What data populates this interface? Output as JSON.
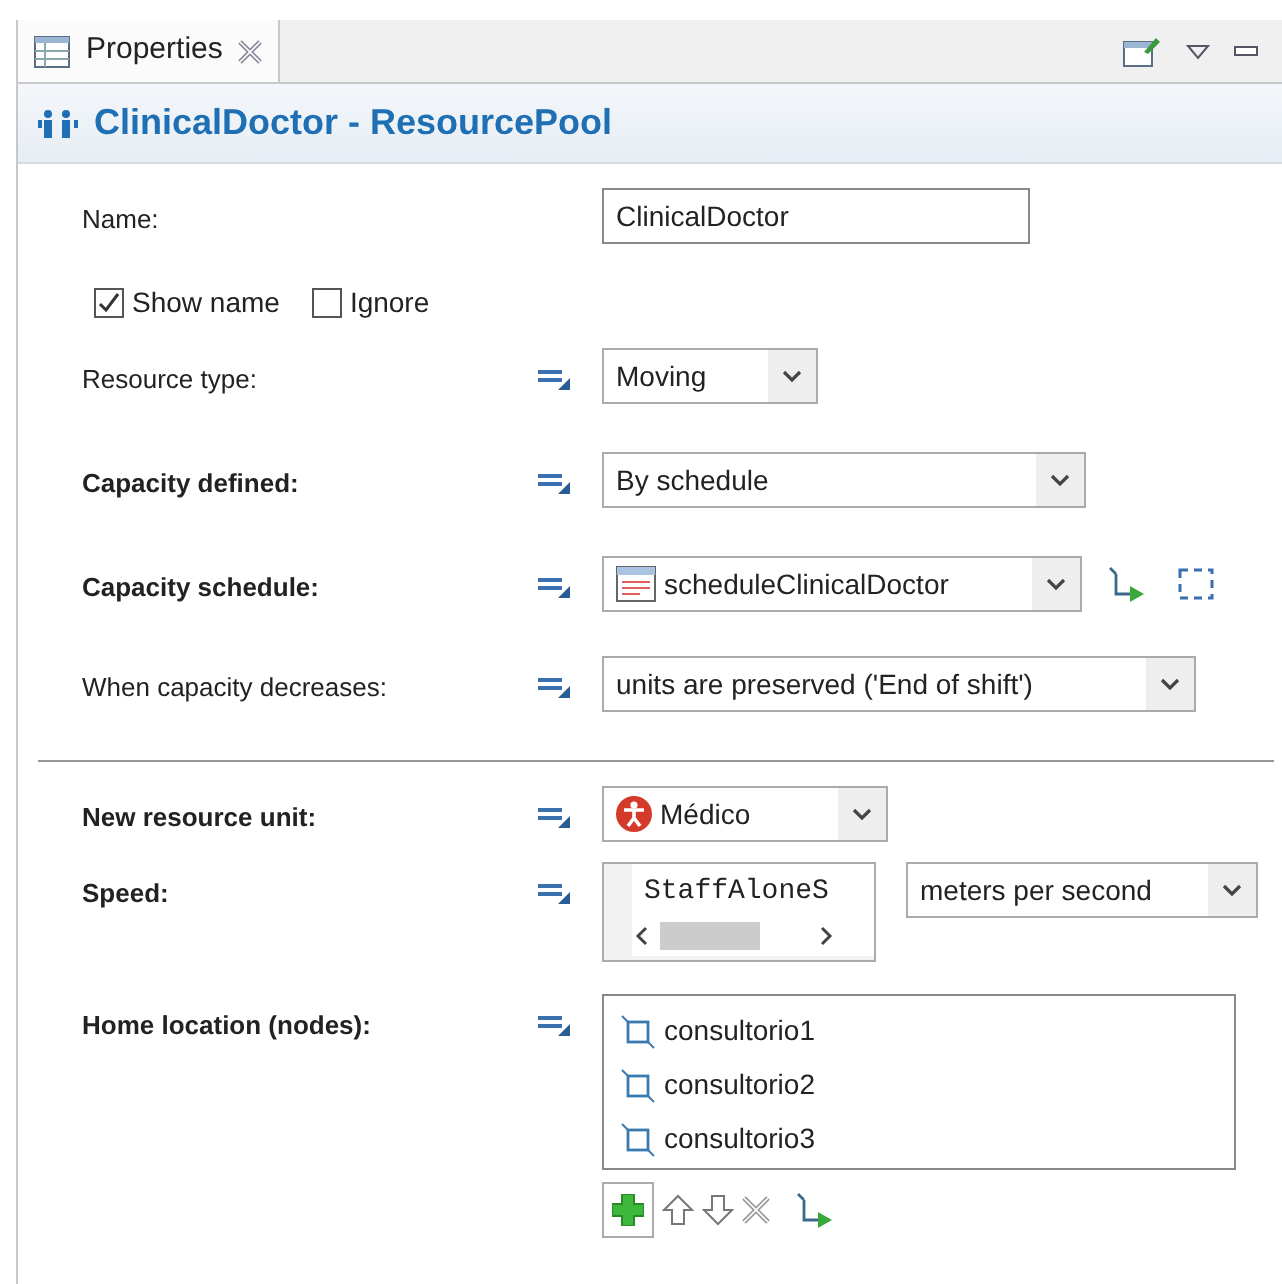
{
  "tab": {
    "label": "Properties",
    "selected": true
  },
  "title": "ClinicalDoctor - ResourcePool",
  "fields": [
    {
      "kind": "text",
      "label": "Name:",
      "bold": false,
      "value": "ClinicalDoctor"
    },
    {
      "kind": "checks",
      "items": [
        {
          "label": "Show name",
          "checked": true
        },
        {
          "label": "Ignore",
          "checked": false
        }
      ]
    },
    {
      "kind": "combo",
      "label": "Resource type:",
      "bold": false,
      "value": "Moving"
    },
    {
      "kind": "combo",
      "label": "Capacity defined:",
      "bold": true,
      "value": "By schedule"
    },
    {
      "kind": "schedule",
      "label": "Capacity schedule:",
      "bold": true,
      "value": "scheduleClinicalDoctor"
    },
    {
      "kind": "combo",
      "label": "When capacity decreases:",
      "bold": false,
      "value": "units are preserved ('End of shift')"
    },
    {
      "kind": "divider"
    },
    {
      "kind": "agent",
      "label": "New resource unit:",
      "bold": true,
      "value": "Médico"
    },
    {
      "kind": "speed",
      "label": "Speed:",
      "bold": true,
      "value": "StaffAloneS",
      "unit": "meters per second"
    },
    {
      "kind": "list",
      "label": "Home location (nodes):",
      "bold": true,
      "items": [
        "consultorio1",
        "consultorio2",
        "consultorio3"
      ]
    }
  ]
}
